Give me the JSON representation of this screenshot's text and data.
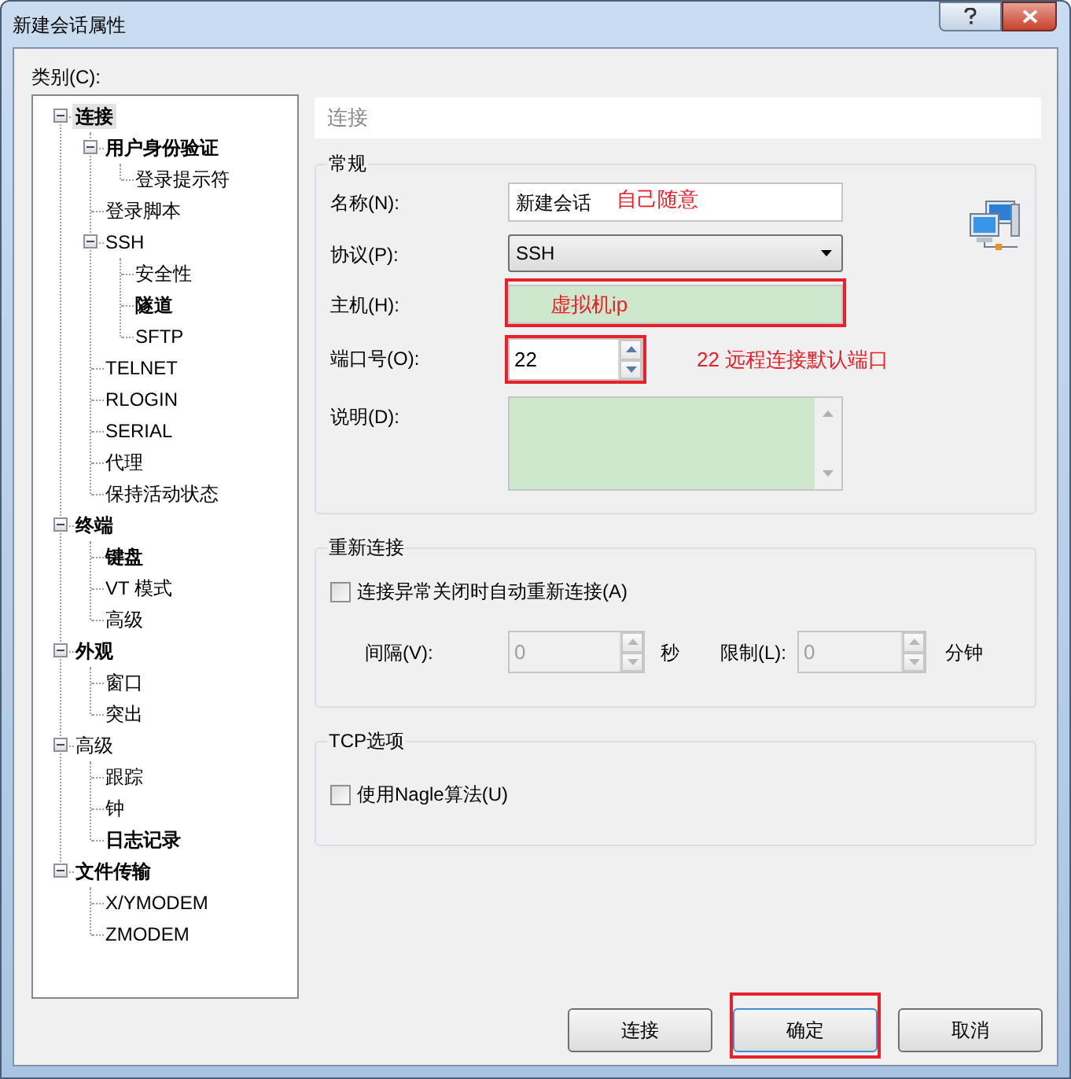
{
  "window": {
    "title": "新建会话属性"
  },
  "category_label": "类别(C):",
  "tree": [
    {
      "label": "连接",
      "bold": true,
      "selected": true,
      "expanded": true,
      "children": [
        {
          "label": "用户身份验证",
          "bold": true,
          "selected": false,
          "expanded": true,
          "children": [
            {
              "label": "登录提示符",
              "bold": false,
              "selected": false
            }
          ]
        },
        {
          "label": "登录脚本",
          "bold": false,
          "selected": false
        },
        {
          "label": "SSH",
          "bold": false,
          "selected": false,
          "expanded": true,
          "children": [
            {
              "label": "安全性",
              "bold": false,
              "selected": false
            },
            {
              "label": "隧道",
              "bold": true,
              "selected": false
            },
            {
              "label": "SFTP",
              "bold": false,
              "selected": false
            }
          ]
        },
        {
          "label": "TELNET",
          "bold": false,
          "selected": false
        },
        {
          "label": "RLOGIN",
          "bold": false,
          "selected": false
        },
        {
          "label": "SERIAL",
          "bold": false,
          "selected": false
        },
        {
          "label": "代理",
          "bold": false,
          "selected": false
        },
        {
          "label": "保持活动状态",
          "bold": false,
          "selected": false
        }
      ]
    },
    {
      "label": "终端",
      "bold": true,
      "selected": false,
      "expanded": true,
      "children": [
        {
          "label": "键盘",
          "bold": true,
          "selected": false
        },
        {
          "label": "VT 模式",
          "bold": false,
          "selected": false
        },
        {
          "label": "高级",
          "bold": false,
          "selected": false
        }
      ]
    },
    {
      "label": "外观",
      "bold": true,
      "selected": false,
      "expanded": true,
      "children": [
        {
          "label": "窗口",
          "bold": false,
          "selected": false
        },
        {
          "label": "突出",
          "bold": false,
          "selected": false
        }
      ]
    },
    {
      "label": "高级",
      "bold": false,
      "selected": false,
      "expanded": true,
      "children": [
        {
          "label": "跟踪",
          "bold": false,
          "selected": false
        },
        {
          "label": "钟",
          "bold": false,
          "selected": false
        },
        {
          "label": "日志记录",
          "bold": true,
          "selected": false
        }
      ]
    },
    {
      "label": "文件传输",
      "bold": true,
      "selected": false,
      "expanded": true,
      "children": [
        {
          "label": "X/YMODEM",
          "bold": false,
          "selected": false
        },
        {
          "label": "ZMODEM",
          "bold": false,
          "selected": false
        }
      ]
    }
  ],
  "panel": {
    "header": "连接",
    "general": {
      "title": "常规",
      "fields": [
        {
          "kind": "text",
          "label": "名称(N):",
          "value": "新建会话",
          "note": "自己随意",
          "highlighted": false,
          "annotated": false
        },
        {
          "kind": "dropdown",
          "label": "协议(P):",
          "value": "SSH",
          "highlighted": false,
          "annotated": false
        },
        {
          "kind": "text",
          "label": "主机(H):",
          "note": "虚拟机ip",
          "highlighted": true,
          "annotated": true
        },
        {
          "kind": "spinner",
          "label": "端口号(O):",
          "value": "22",
          "note": "22 远程连接默认端口",
          "highlighted": false,
          "annotated": true
        },
        {
          "kind": "textarea",
          "label": "说明(D):",
          "highlighted": true,
          "annotated": false
        }
      ]
    },
    "reconnect": {
      "title": "重新连接",
      "checkbox": {
        "label": "连接异常关闭时自动重新连接(A)",
        "checked": false
      },
      "spinners": [
        {
          "label": "间隔(V):",
          "value": "0",
          "unit": "秒",
          "disabled": true
        },
        {
          "label": "限制(L):",
          "value": "0",
          "unit": "分钟",
          "disabled": true
        }
      ]
    },
    "tcp": {
      "title": "TCP选项",
      "checkbox": {
        "label": "使用Nagle算法(U)",
        "checked": false
      }
    }
  },
  "buttons": [
    {
      "label": "连接",
      "focused": false,
      "annotated": false
    },
    {
      "label": "确定",
      "focused": true,
      "annotated": true
    },
    {
      "label": "取消",
      "focused": false,
      "annotated": false
    }
  ]
}
